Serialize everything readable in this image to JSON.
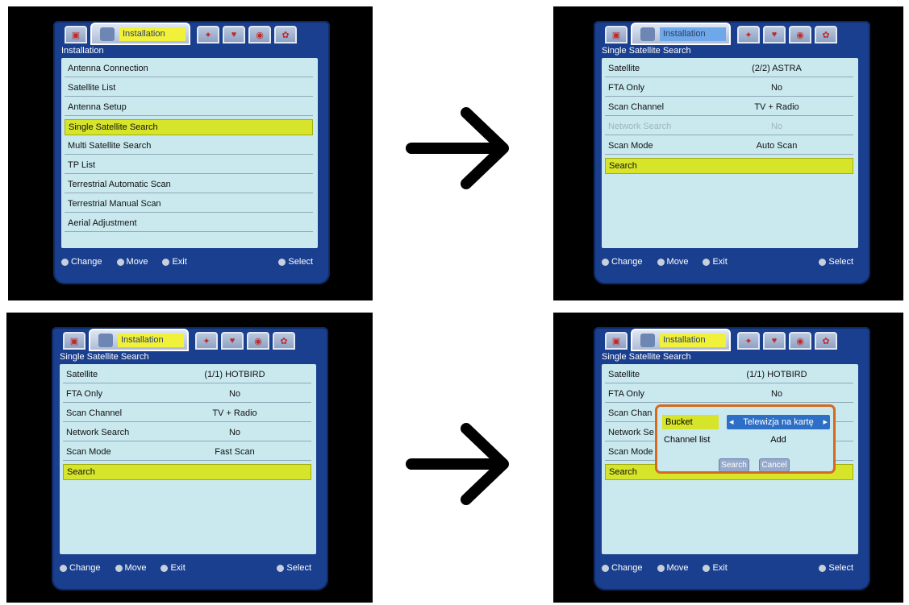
{
  "colors": {
    "accent": "#d6e52a",
    "frame": "#1a3f8e",
    "list": "#c9e9ef",
    "popup_border": "#d46a1e"
  },
  "tab_label": "Installation",
  "footer": {
    "change": "Change",
    "move": "Move",
    "exit": "Exit",
    "select": "Select"
  },
  "arrows": [
    "arrow-right-icon",
    "arrow-right-icon"
  ],
  "screen1": {
    "title": "Installation",
    "items": [
      "Antenna Connection",
      "Satellite List",
      "Antenna Setup",
      "Single Satellite Search",
      "Multi Satellite Search",
      "TP List",
      "Terrestrial Automatic Scan",
      "Terrestrial Manual Scan",
      "Aerial Adjustment"
    ],
    "selected_index": 3
  },
  "screen2": {
    "title": "Single Satellite Search",
    "rows": [
      {
        "label": "Satellite",
        "value": "(2/2) ASTRA"
      },
      {
        "label": "FTA Only",
        "value": "No"
      },
      {
        "label": "Scan Channel",
        "value": "TV + Radio"
      },
      {
        "label": "Network Search",
        "value": "No",
        "disabled": true
      },
      {
        "label": "Scan Mode",
        "value": "Auto Scan"
      },
      {
        "label": "Search",
        "value": ""
      }
    ],
    "selected_index": 5
  },
  "screen3": {
    "title": "Single Satellite Search",
    "rows": [
      {
        "label": "Satellite",
        "value": "(1/1) HOTBIRD"
      },
      {
        "label": "FTA Only",
        "value": "No"
      },
      {
        "label": "Scan Channel",
        "value": "TV + Radio"
      },
      {
        "label": "Network Search",
        "value": "No"
      },
      {
        "label": "Scan Mode",
        "value": "Fast Scan"
      },
      {
        "label": "Search",
        "value": ""
      }
    ],
    "selected_index": 5
  },
  "screen4": {
    "title": "Single Satellite Search",
    "rows": [
      {
        "label": "Satellite",
        "value": "(1/1) HOTBIRD"
      },
      {
        "label": "FTA Only",
        "value": "No"
      },
      {
        "label": "Scan Chan",
        "value": ""
      },
      {
        "label": "Network Se",
        "value": ""
      },
      {
        "label": "Scan Mode",
        "value": ""
      },
      {
        "label": "Search",
        "value": ""
      }
    ],
    "selected_index": 5,
    "popup": {
      "bucket_label": "Bucket",
      "bucket_value": "Telewizja na kartę",
      "channel_list_label": "Channel list",
      "channel_list_value": "Add",
      "search_button": "Search",
      "cancel_button": "Cancel"
    }
  }
}
